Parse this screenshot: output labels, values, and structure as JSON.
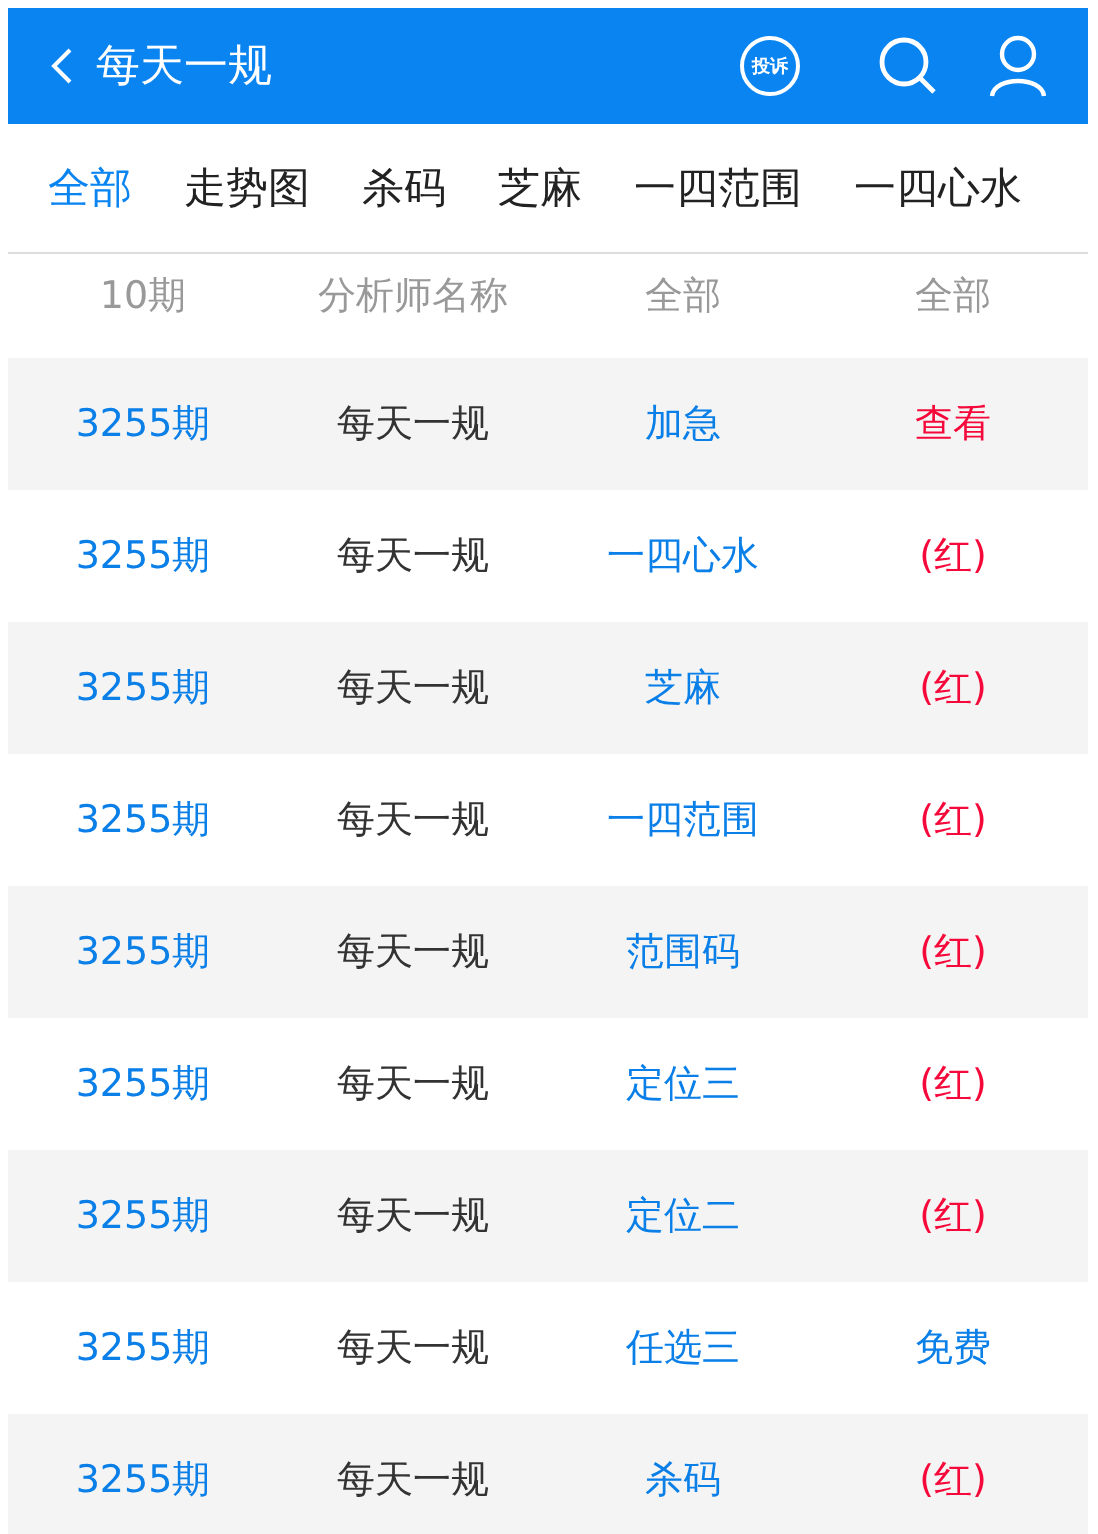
{
  "header": {
    "title": "每天一规",
    "complaint_badge": "投诉"
  },
  "tabs": [
    {
      "label": "全部",
      "selected": true
    },
    {
      "label": "走势图",
      "selected": false
    },
    {
      "label": "杀码",
      "selected": false
    },
    {
      "label": "芝麻",
      "selected": false
    },
    {
      "label": "一四范围",
      "selected": false
    },
    {
      "label": "一四心水",
      "selected": false
    }
  ],
  "table": {
    "columns": [
      "10期",
      "分析师名称",
      "全部",
      "全部"
    ],
    "rows": [
      {
        "period": "3255期",
        "analyst": "每天一规",
        "category": "加急",
        "result": "查看",
        "kind": "paid"
      },
      {
        "period": "3255期",
        "analyst": "每天一规",
        "category": "一四心水",
        "result": "(红)",
        "kind": "paid"
      },
      {
        "period": "3255期",
        "analyst": "每天一规",
        "category": "芝麻",
        "result": "(红)",
        "kind": "paid"
      },
      {
        "period": "3255期",
        "analyst": "每天一规",
        "category": "一四范围",
        "result": "(红)",
        "kind": "paid"
      },
      {
        "period": "3255期",
        "analyst": "每天一规",
        "category": "范围码",
        "result": "(红)",
        "kind": "paid"
      },
      {
        "period": "3255期",
        "analyst": "每天一规",
        "category": "定位三",
        "result": "(红)",
        "kind": "paid"
      },
      {
        "period": "3255期",
        "analyst": "每天一规",
        "category": "定位二",
        "result": "(红)",
        "kind": "paid"
      },
      {
        "period": "3255期",
        "analyst": "每天一规",
        "category": "任选三",
        "result": "免费",
        "kind": "free"
      },
      {
        "period": "3255期",
        "analyst": "每天一规",
        "category": "杀码",
        "result": "(红)",
        "kind": "paid"
      }
    ]
  }
}
